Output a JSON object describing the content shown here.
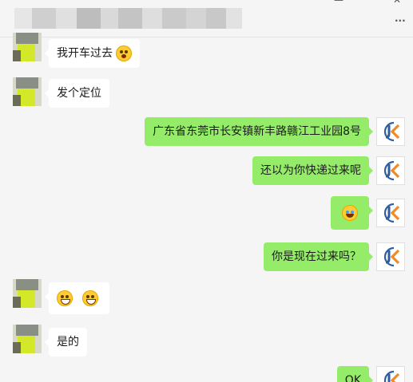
{
  "window": {
    "controls": {
      "minimize": "—",
      "more": "···"
    }
  },
  "messages": [
    {
      "side": "left",
      "text": "我开车过去",
      "emoji": [
        "dizzy-face"
      ]
    },
    {
      "side": "left",
      "text": "发个定位",
      "emoji": []
    },
    {
      "side": "right",
      "text": "广东省东莞市长安镇新丰路赣江工业园8号",
      "emoji": []
    },
    {
      "side": "right",
      "text": "还以为你快递过来呢",
      "emoji": []
    },
    {
      "side": "right",
      "text": "",
      "emoji": [
        "tears-of-joy"
      ]
    },
    {
      "side": "right",
      "text": "你是现在过来吗？",
      "emoji": []
    },
    {
      "side": "left",
      "text": "",
      "emoji": [
        "grin",
        "grin"
      ]
    },
    {
      "side": "left",
      "text": "是的",
      "emoji": []
    },
    {
      "side": "right",
      "text": "OK",
      "emoji": []
    }
  ],
  "colors": {
    "self_bubble": "#95ec69",
    "other_bubble": "#ffffff",
    "background": "#f5f5f5",
    "jk_blue": "#2f5d9e",
    "jk_orange": "#f08a24"
  },
  "avatars": {
    "self_logo": "JK"
  }
}
